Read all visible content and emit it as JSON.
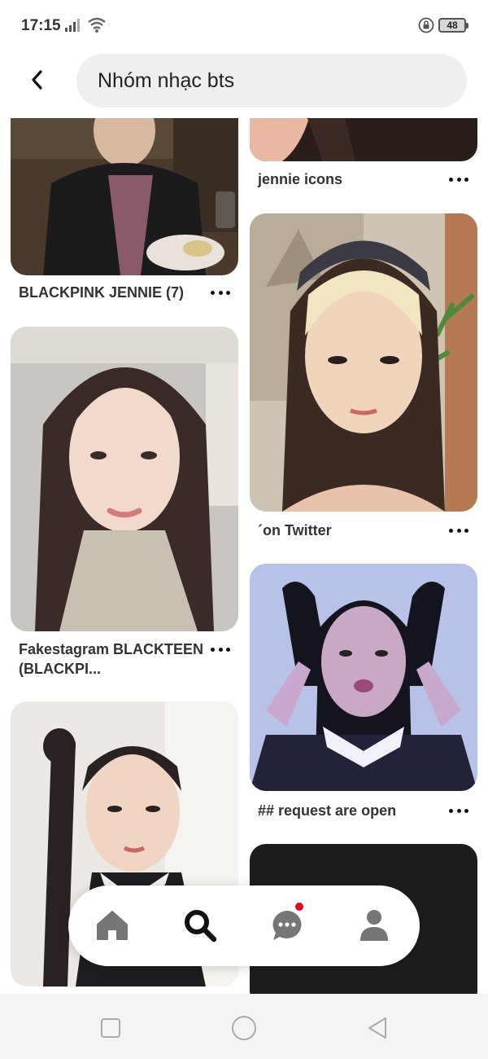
{
  "status_bar": {
    "time": "17:15",
    "battery": "48",
    "icons": [
      "signal-icon",
      "wifi-icon",
      "lock-rotation-icon",
      "battery-icon"
    ]
  },
  "header": {
    "back_icon": "chevron-left-icon",
    "search_value": "Nhóm nhạc bts"
  },
  "feed": {
    "pins": [
      {
        "title": "BLACKPINK JENNIE (7)",
        "column": "left"
      },
      {
        "title": "Fakestagram BLACKTEEN (BLACKPI...",
        "column": "left"
      },
      {
        "title": "",
        "column": "left"
      },
      {
        "title": "jennie icons",
        "column": "right"
      },
      {
        "title": "´on Twitter",
        "column": "right"
      },
      {
        "title": "## request are open",
        "column": "right"
      },
      {
        "title": "",
        "column": "right"
      }
    ],
    "more_icon": "more-options-icon"
  },
  "bottom_nav": {
    "items": [
      {
        "name": "home",
        "icon": "home-icon",
        "active": false
      },
      {
        "name": "search",
        "icon": "search-icon",
        "active": true
      },
      {
        "name": "messages",
        "icon": "chat-icon",
        "has_notification": true
      },
      {
        "name": "profile",
        "icon": "user-icon",
        "active": false
      }
    ],
    "notification_color": "#e60023"
  },
  "system_nav": {
    "icons": [
      "recent-apps-icon",
      "home-circle-icon",
      "back-triangle-icon"
    ]
  }
}
